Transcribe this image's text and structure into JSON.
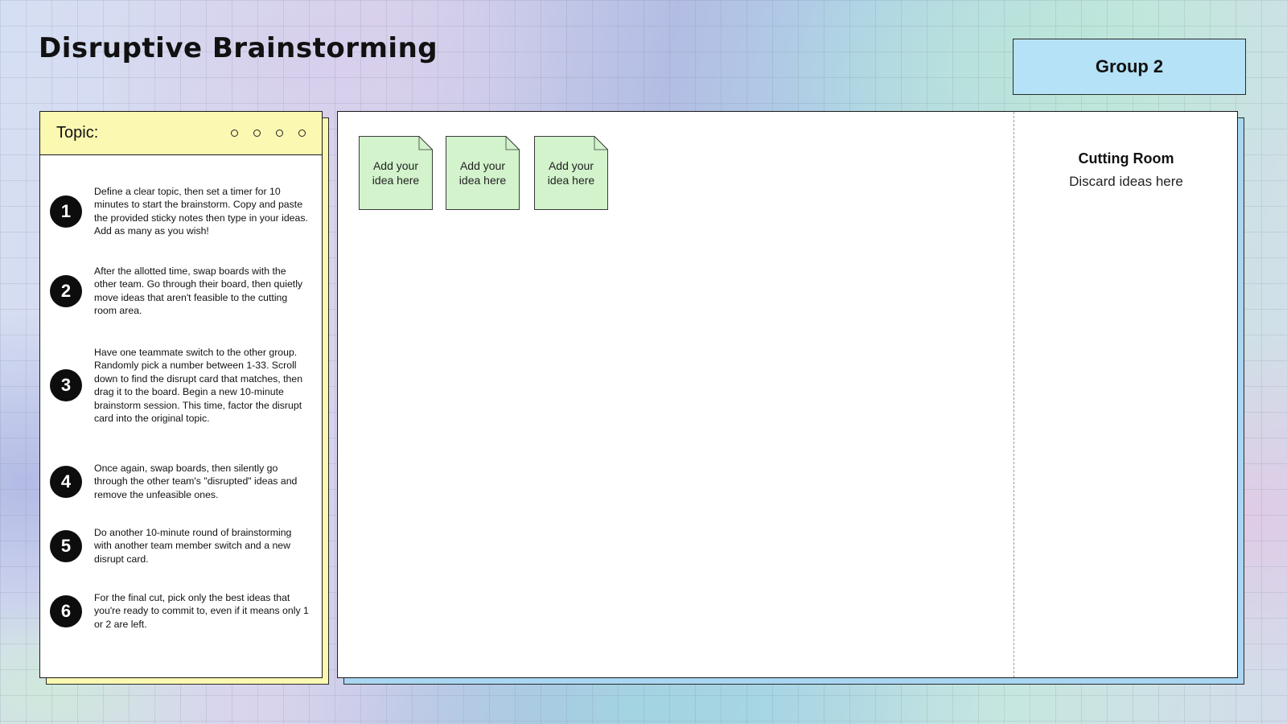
{
  "page": {
    "title": "Disruptive Brainstorming",
    "group_label": "Group 2"
  },
  "instructions": {
    "topic_label": "Topic:",
    "steps": [
      {
        "number": "1",
        "text": "Define a clear topic, then set a timer for 10 minutes to start the brainstorm. Copy and paste the provided sticky notes then type in your ideas. Add as many as you wish!"
      },
      {
        "number": "2",
        "text": "After the allotted time, swap boards with the other team. Go through their board, then quietly move ideas that aren't feasible to the cutting room area."
      },
      {
        "number": "3",
        "text": "Have one teammate switch to the other group. Randomly pick a number between 1-33. Scroll down to find the disrupt card that matches, then drag it to the board. Begin a new 10-minute brainstorm session. This time, factor the disrupt card into the original topic."
      },
      {
        "number": "4",
        "text": "Once again, swap boards, then silently go through the other team's \"disrupted\" ideas and remove the unfeasible ones."
      },
      {
        "number": "5",
        "text": "Do another 10-minute round of brainstorming with another team member switch and a new disrupt card."
      },
      {
        "number": "6",
        "text": "For the final cut, pick only the best ideas that you're ready to commit to, even if it means only 1 or 2 are left."
      }
    ]
  },
  "board": {
    "sticky_notes": [
      {
        "text": "Add your idea here"
      },
      {
        "text": "Add your idea here"
      },
      {
        "text": "Add your idea here"
      }
    ],
    "cutting_room": {
      "title": "Cutting Room",
      "subtitle": "Discard ideas here"
    }
  },
  "colors": {
    "topic_yellow": "#fbf8b2",
    "group_blue": "#b6e2f7",
    "board_shadow_blue": "#a9d6f2",
    "sticky_green": "#d2f3cc",
    "step_badge": "#0d0d0d"
  }
}
